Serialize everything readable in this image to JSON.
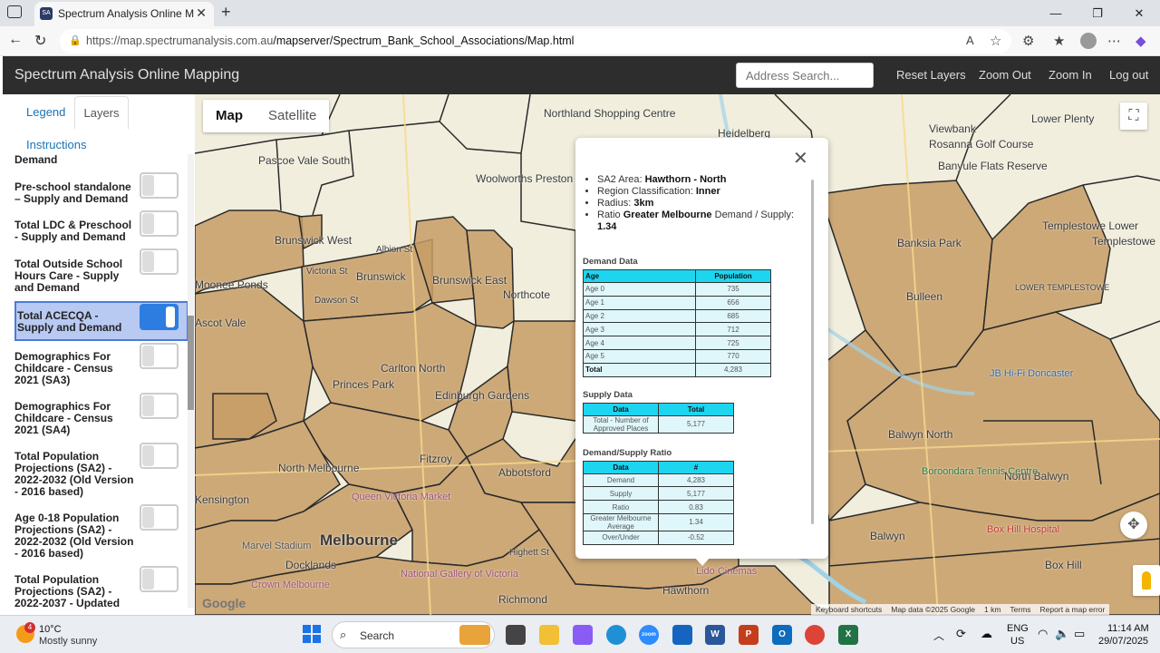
{
  "browser": {
    "tab_title": "Spectrum Analysis Online Mapping",
    "url_host": "https://map.spectrumanalysis.com.au",
    "url_path": "/mapserver/Spectrum_Bank_School_Associations/Map.html"
  },
  "app": {
    "title": "Spectrum Analysis Online Mapping",
    "address_placeholder": "Address Search...",
    "nav": [
      "Reset Layers",
      "Zoom Out",
      "Zoom In",
      "Log out"
    ]
  },
  "sidebar": {
    "tabs": {
      "legend": "Legend",
      "layers": "Layers",
      "instructions": "Instructions"
    },
    "layers": [
      {
        "label": "Demand",
        "on": false
      },
      {
        "label": "Pre-school standalone – Supply and Demand",
        "on": false
      },
      {
        "label": "Total LDC & Preschool - Supply and Demand",
        "on": false
      },
      {
        "label": "Total Outside School Hours Care - Supply and Demand",
        "on": false
      },
      {
        "label": "Total ACECQA - Supply and Demand",
        "on": true
      },
      {
        "label": "Demographics For Childcare - Census 2021 (SA3)",
        "on": false
      },
      {
        "label": "Demographics For Childcare - Census 2021 (SA4)",
        "on": false
      },
      {
        "label": "Total Population Projections (SA2) - 2022-2032 (Old Version - 2016 based)",
        "on": false
      },
      {
        "label": "Age 0-18 Population Projections (SA2) - 2022-2032 (Old Version - 2016 based)",
        "on": false
      },
      {
        "label": "Total Population Projections (SA2) - 2022-2037 - Updated",
        "on": false
      }
    ]
  },
  "map": {
    "types": {
      "map": "Map",
      "satellite": "Satellite"
    },
    "labels": [
      "Pascoe Vale South",
      "Brunswick West",
      "Brunswick",
      "Brunswick East",
      "Northcote",
      "Carlton North",
      "Princes Park",
      "Edinburgh Gardens",
      "Fitzroy",
      "North Melbourne",
      "Abbotsford",
      "Melbourne",
      "Docklands",
      "Richmond",
      "Hawthorn",
      "Bulleen",
      "Templestowe Lower",
      "Balwyn North",
      "Balwyn",
      "North Balwyn",
      "Box Hill",
      "Lower Plenty",
      "Viewbank",
      "Heidelberg",
      "Banksia Park",
      "Moonee Ponds",
      "Ascot Vale",
      "Kensington",
      "Rosanna Golf Course",
      "Banyule Flats Reserve",
      "Templestowe",
      "Northland Shopping Centre",
      "Woolworths Preston South",
      "Albion St",
      "Victoria St",
      "Dawson St",
      "Queen Victoria Market",
      "Marvel Stadium",
      "Crown Melbourne",
      "National Gallery of Victoria",
      "Highett St",
      "Lido Cinemas",
      "Boroondara Tennis Centre",
      "JB Hi-Fi Doncaster",
      "LOWER TEMPLESTOWE",
      "Box Hill Hospital"
    ],
    "google": "Google",
    "attribution": [
      "Keyboard shortcuts",
      "Map data ©2025 Google",
      "1 km",
      "Terms",
      "Report a map error"
    ]
  },
  "popup": {
    "summary": {
      "sa2_label": "SA2 Area:",
      "sa2_value": "Hawthorn - North",
      "region_label": "Region Classification:",
      "region_value": "Inner",
      "radius_label": "Radius:",
      "radius_value": "3km",
      "ratio_label_a": "Ratio",
      "ratio_label_b": "Greater Melbourne",
      "ratio_label_c": "Demand / Supply:",
      "ratio_value": "1.34"
    },
    "demand": {
      "title": "Demand Data",
      "headers": [
        "Age",
        "Population"
      ],
      "rows": [
        [
          "Age 0",
          "735"
        ],
        [
          "Age 1",
          "656"
        ],
        [
          "Age 2",
          "685"
        ],
        [
          "Age 3",
          "712"
        ],
        [
          "Age 4",
          "725"
        ],
        [
          "Age 5",
          "770"
        ],
        [
          "Total",
          "4,283"
        ]
      ]
    },
    "supply": {
      "title": "Supply Data",
      "headers": [
        "Data",
        "Total"
      ],
      "rows": [
        [
          "Total - Number of Approved Places",
          "5,177"
        ]
      ]
    },
    "ratio": {
      "title": "Demand/Supply Ratio",
      "headers": [
        "Data",
        "#"
      ],
      "rows": [
        [
          "Demand",
          "4,283"
        ],
        [
          "Supply",
          "5,177"
        ],
        [
          "Ratio",
          "0.83"
        ],
        [
          "Greater Melbourne Average",
          "1.34"
        ],
        [
          "Over/Under",
          "-0.52"
        ]
      ]
    }
  },
  "taskbar": {
    "badge": "4",
    "temp": "10°C",
    "weather": "Mostly sunny",
    "search": "Search",
    "lang_a": "ENG",
    "lang_b": "US",
    "time": "11:14 AM",
    "date": "29/07/2025"
  }
}
